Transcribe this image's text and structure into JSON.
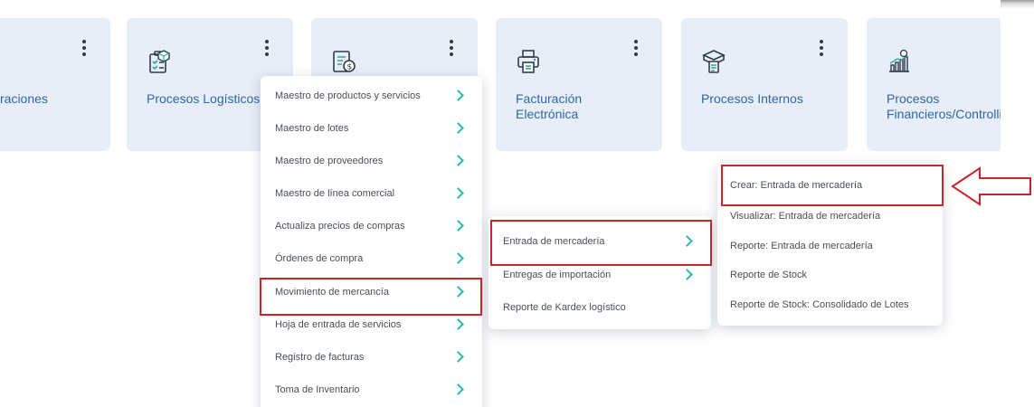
{
  "watermark": "▀ ■ ░ ▓ ▲ ◎",
  "tiles": [
    {
      "label": "raciones",
      "icon": "operations-icon"
    },
    {
      "label": "Procesos Logísticos",
      "icon": "logistics-clipboard-icon"
    },
    {
      "label": "",
      "icon": "invoice-money-icon"
    },
    {
      "label": "Facturación Electrónica",
      "label_line1": "Facturación",
      "label_line2": "Electrónica",
      "icon": "printer-invoice-icon"
    },
    {
      "label": "Procesos Internos",
      "icon": "internal-processes-box-icon"
    },
    {
      "label": "Procesos Financieros/Controlling",
      "label_line1": "Procesos",
      "label_line2": "Financieros/Controlli",
      "icon": "finance-chart-icon"
    }
  ],
  "menu1": {
    "items": [
      "Maestro de productos y servicios",
      "Maestro de lotes",
      "Maestro de proveedores",
      "Maestro de línea comercial",
      "Actualiza precios de compras",
      "Órdenes de compra",
      "Movimiento de mercancía",
      "Hoja de entrada de servicios",
      "Registro de facturas",
      "Toma de Inventario"
    ],
    "highlighted": "Movimiento de mercancía"
  },
  "menu2": {
    "items": [
      "Entrada de mercadería",
      "Entregas de importación",
      "Reporte de Kardex logístico"
    ],
    "highlighted": "Entrada de mercadería"
  },
  "menu3": {
    "items": [
      "Crear: Entrada de mercadería",
      "Visualizar: Entrada de mercadería",
      "Reporte: Entrada de mercadería",
      "Reporte de Stock",
      "Reporte de Stock: Consolidado de Lotes"
    ],
    "highlighted": "Crear: Entrada de mercadería"
  },
  "colors": {
    "tile_bg": "#e7eef7",
    "tile_label": "#2f66a6",
    "chevron": "#2db8b0",
    "highlight": "#c8262c",
    "icon_teal": "#2aa79f",
    "icon_dark": "#2f3b4a"
  }
}
